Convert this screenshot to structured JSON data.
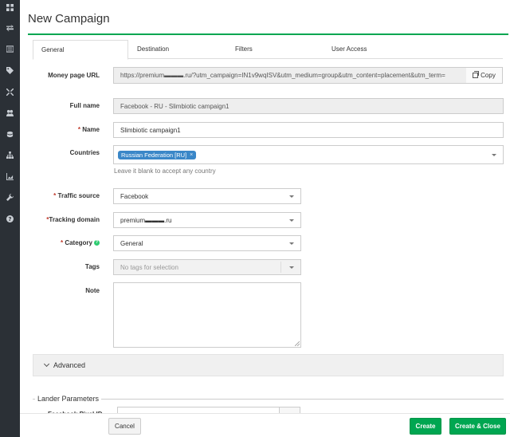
{
  "page": {
    "title": "New Campaign"
  },
  "tabs": [
    {
      "label": "General"
    },
    {
      "label": "Destination"
    },
    {
      "label": "Filters"
    },
    {
      "label": "User Access"
    }
  ],
  "form": {
    "money_page_url": {
      "label": "Money page URL",
      "value": "https://premium▬▬▬.ru/?utm_campaign=IN1v9wqISV&utm_medium=group&utm_content=placement&utm_term=",
      "copy_label": "Copy"
    },
    "full_name": {
      "label": "Full name",
      "value": "Facebook - RU - Slimbiotic campaign1"
    },
    "name": {
      "required": "*",
      "label": "Name",
      "value": "Slimbiotic campaign1"
    },
    "countries": {
      "label": "Countries",
      "chip": "Russian Federation [RU]",
      "chip_remove": "×",
      "hint": "Leave it blank to accept any country"
    },
    "traffic_source": {
      "required": "*",
      "label": "Traffic source",
      "value": "Facebook"
    },
    "tracking_domain": {
      "required": "*",
      "label": "Tracking domain",
      "value": "premium▬▬▬.ru"
    },
    "category": {
      "required": "*",
      "label": "Category",
      "help": "?",
      "value": "General"
    },
    "tags": {
      "label": "Tags",
      "placeholder": "No tags for selection"
    },
    "note": {
      "label": "Note",
      "value": ""
    }
  },
  "advanced": {
    "label": "Advanced"
  },
  "lander": {
    "legend": "Lander Parameters",
    "partial_label": "Facebook Pixel ID"
  },
  "footer": {
    "cancel": "Cancel",
    "create": "Create",
    "create_close": "Create & Close"
  },
  "colors": {
    "accent": "#00a651",
    "chip": "#3a87c8",
    "sidebar": "#2b3036"
  },
  "sidebar_icons": [
    "dashboard-icon",
    "transfer-icon",
    "list-icon",
    "tag-icon",
    "crosshair-icon",
    "users-icon",
    "coins-icon",
    "sitemap-icon",
    "chart-icon",
    "wrench-icon",
    "help-icon"
  ]
}
